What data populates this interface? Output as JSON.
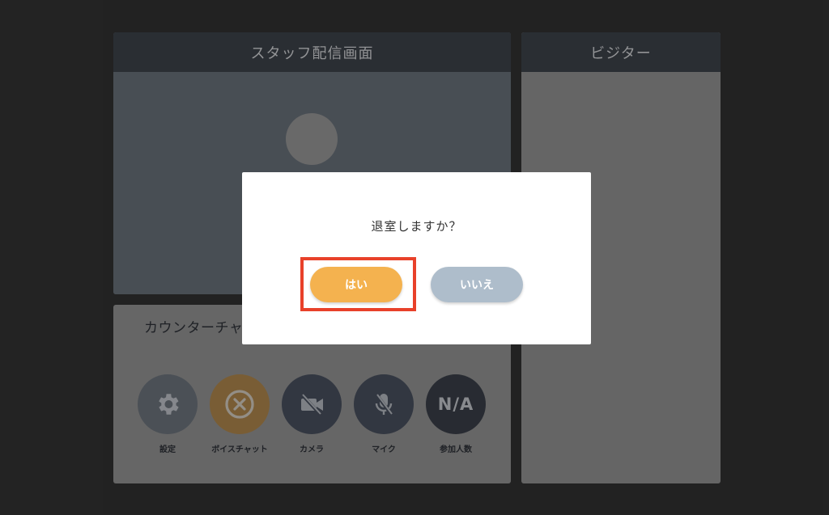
{
  "staff_panel": {
    "title": "スタッフ配信画面"
  },
  "visitor_panel": {
    "title": "ビジター"
  },
  "chat_panel": {
    "title": "カウンターチャット",
    "controls": [
      {
        "label": "設定",
        "icon": "gear-icon",
        "color": "#6f767f"
      },
      {
        "label": "ボイスチャット",
        "icon": "circle-x-icon",
        "color": "#b38a4f"
      },
      {
        "label": "カメラ",
        "icon": "camera-off-icon",
        "color": "#4a5160"
      },
      {
        "label": "マイク",
        "icon": "mic-off-icon",
        "color": "#4a5160"
      },
      {
        "label": "参加人数",
        "icon": "na-badge",
        "value": "N/A",
        "color": "#3b404a"
      }
    ]
  },
  "modal": {
    "message": "退室しますか？",
    "yes_label": "はい",
    "no_label": "いいえ",
    "highlight_color": "#e8412a"
  },
  "colors": {
    "background": "#333333",
    "header": "#3e444c",
    "yes_button": "#f4b24f",
    "no_button": "#aebdcb"
  }
}
